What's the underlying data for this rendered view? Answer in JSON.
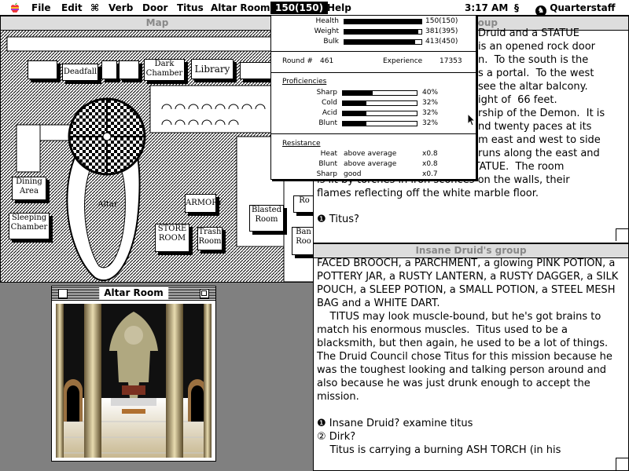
{
  "menubar": {
    "items": [
      "File",
      "Edit",
      "⌘",
      "Verb",
      "Door",
      "Titus",
      "Altar Room"
    ],
    "selected": "150(150)",
    "help": "Help",
    "clock": "3:17 AM",
    "character": "Quarterstaff"
  },
  "status": {
    "health": {
      "label": "Health",
      "value": "150(150)",
      "fraction": 1.0
    },
    "weight": {
      "label": "Weight",
      "value": "381(395)",
      "fraction": 0.96
    },
    "bulk": {
      "label": "Bulk",
      "value": "413(450)",
      "fraction": 0.92
    },
    "round_label": "Round #",
    "round": "461",
    "experience_label": "Experience",
    "experience": "17353",
    "proficiencies_title": "Proficiencies",
    "proficiencies": [
      {
        "name": "Sharp",
        "value": "40%",
        "fraction": 0.4
      },
      {
        "name": "Cold",
        "value": "32%",
        "fraction": 0.32
      },
      {
        "name": "Acid",
        "value": "32%",
        "fraction": 0.32
      },
      {
        "name": "Blunt",
        "value": "32%",
        "fraction": 0.32
      }
    ],
    "resistance_title": "Resistance",
    "resistance": [
      {
        "name": "Heat",
        "level": "above average",
        "mult": "x0.8"
      },
      {
        "name": "Blunt",
        "level": "above average",
        "mult": "x0.8"
      },
      {
        "name": "Sharp",
        "level": "good",
        "mult": "x0.7"
      }
    ]
  },
  "map": {
    "title": "Map",
    "rooms": {
      "deadfall": "Deadfall",
      "dark_chamber": "Dark Chamber",
      "library": "Library",
      "dining_area": "Dining Area",
      "sleeping_chamber": "Sleeping Chamber",
      "altar": "Altar",
      "armory": "ARMORY",
      "store_room": "STORE ROOM",
      "trash_room": "Trash Room",
      "blasted_room": "Blasted Room",
      "ro": "Ro",
      "ban": "Ban Roo"
    }
  },
  "altar_window": {
    "title": "Altar Room"
  },
  "top_text": {
    "title_fragment": "group",
    "lines_visible": [
      "Druid and a STATUE",
      "is an opened rock door",
      "n.  To the south is the",
      "s a portal.  To the west",
      "see the altar balcony.",
      "ight of  66 feet.",
      "rship of the Demon.  It is",
      "nd twenty paces at its",
      "m east and west to side",
      "runs along the east and",
      "in the center is an enormous STATUE.  The room",
      "is lit by torches in iron sconces on the walls, their",
      "flames reflecting off the white marble floor."
    ],
    "prompt": "Titus?"
  },
  "druid_text": {
    "title": "Insane Druid's group",
    "para1": "FACED BROOCH, a PARCHMENT, a glowing PINK POTION, a POTTERY JAR, a RUSTY LANTERN, a RUSTY DAGGER, a SILK POUCH, a SLEEP POTION, a SMALL POTION, a STEEL MESH BAG and a WHITE DART.",
    "para2": "    TITUS may look muscle-bound, but he's got brains to match his enormous muscles.  Titus used to be a blacksmith, but then again, he used to be a lot of things.  The Druid Council chose Titus for this mission because he was the toughest looking and talking person around and also because he was just drunk enough to accept the mission.",
    "prompt1": "Insane Druid? examine titus",
    "prompt2": "Dirk?",
    "para3": "    Titus is carrying a burning ASH TORCH (in his"
  }
}
